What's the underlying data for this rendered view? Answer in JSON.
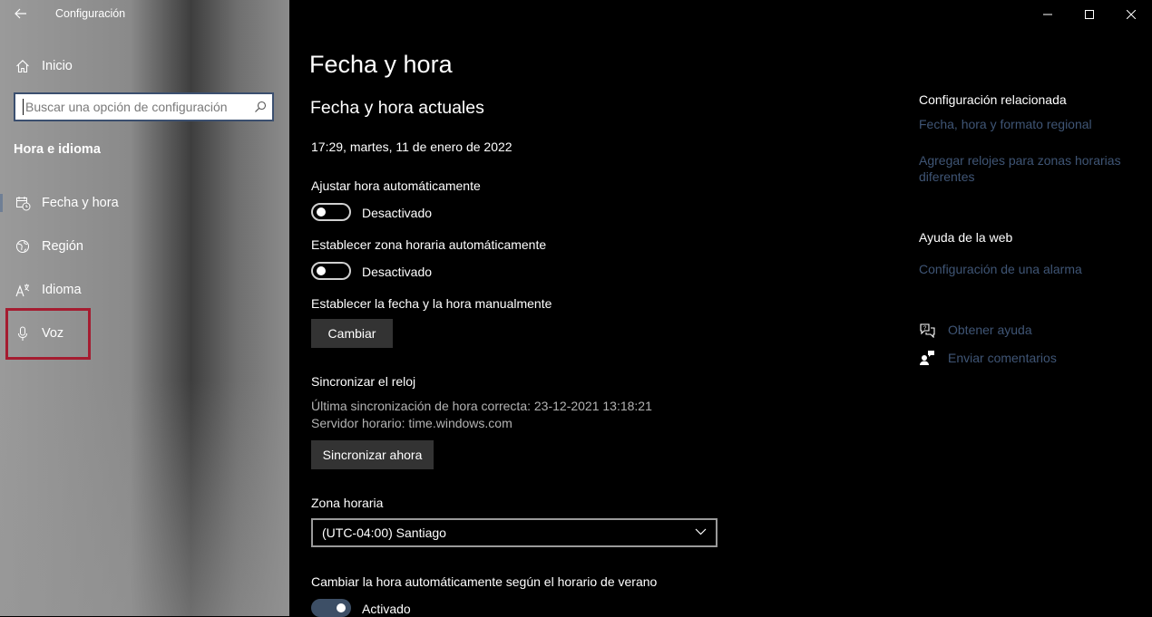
{
  "window": {
    "app_title": "Configuración"
  },
  "sidebar": {
    "home_label": "Inicio",
    "search_placeholder": "Buscar una opción de configuración",
    "section_title": "Hora e idioma",
    "items": [
      {
        "label": "Fecha y hora",
        "icon": "calendar-clock-icon",
        "active": true
      },
      {
        "label": "Región",
        "icon": "globe-icon",
        "active": false
      },
      {
        "label": "Idioma",
        "icon": "language-icon",
        "active": false
      },
      {
        "label": "Voz",
        "icon": "microphone-icon",
        "active": false
      }
    ],
    "highlight_color": "#a51c30"
  },
  "main": {
    "page_title": "Fecha y hora",
    "current_heading": "Fecha y hora actuales",
    "current_datetime": "17:29, martes, 11 de enero de 2022",
    "auto_time": {
      "label": "Ajustar hora automáticamente",
      "state_label": "Desactivado",
      "on": false
    },
    "auto_zone": {
      "label": "Establecer zona horaria automáticamente",
      "state_label": "Desactivado",
      "on": false
    },
    "manual": {
      "label": "Establecer la fecha y la hora manualmente",
      "button": "Cambiar"
    },
    "sync": {
      "heading": "Sincronizar el reloj",
      "last_sync": "Última sincronización de hora correcta: 23-12-2021 13:18:21",
      "server": "Servidor horario: time.windows.com",
      "button": "Sincronizar ahora"
    },
    "timezone": {
      "label": "Zona horaria",
      "value": "(UTC-04:00) Santiago"
    },
    "dst": {
      "label": "Cambiar la hora automáticamente según el horario de verano",
      "state_label": "Activado",
      "on": true
    }
  },
  "related": {
    "title": "Configuración relacionada",
    "links": [
      "Fecha, hora y formato regional",
      "Agregar relojes para zonas horarias",
      "diferentes"
    ]
  },
  "web_help": {
    "title": "Ayuda de la web",
    "link": "Configuración de una alarma"
  },
  "help": {
    "get_help": "Obtener ayuda",
    "feedback": "Enviar comentarios"
  },
  "colors": {
    "link": "#3f5575",
    "toggle_on": "#3d4f66"
  }
}
